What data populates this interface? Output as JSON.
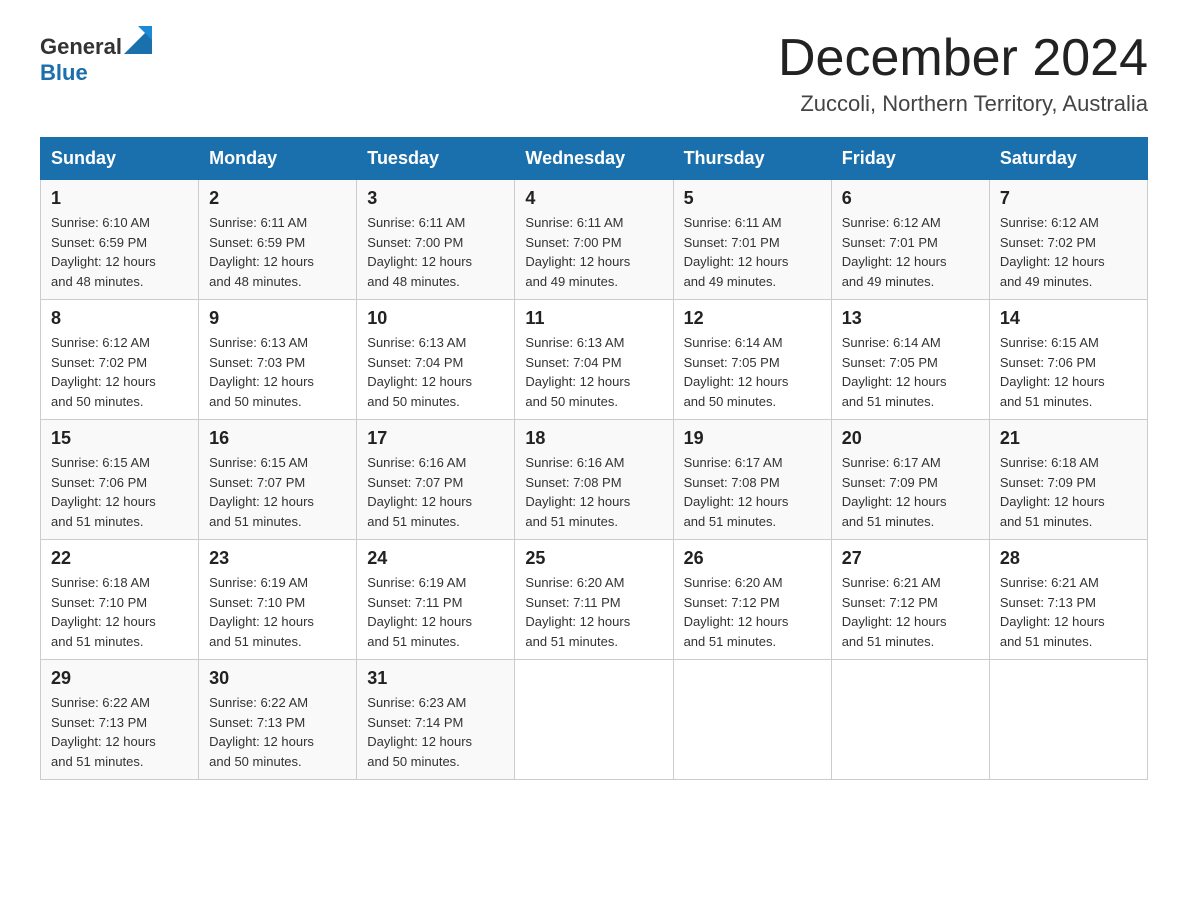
{
  "header": {
    "logo_general": "General",
    "logo_blue": "Blue",
    "month_title": "December 2024",
    "location": "Zuccoli, Northern Territory, Australia"
  },
  "days_of_week": [
    "Sunday",
    "Monday",
    "Tuesday",
    "Wednesday",
    "Thursday",
    "Friday",
    "Saturday"
  ],
  "weeks": [
    [
      {
        "day": "1",
        "sunrise": "6:10 AM",
        "sunset": "6:59 PM",
        "daylight": "12 hours and 48 minutes."
      },
      {
        "day": "2",
        "sunrise": "6:11 AM",
        "sunset": "6:59 PM",
        "daylight": "12 hours and 48 minutes."
      },
      {
        "day": "3",
        "sunrise": "6:11 AM",
        "sunset": "7:00 PM",
        "daylight": "12 hours and 48 minutes."
      },
      {
        "day": "4",
        "sunrise": "6:11 AM",
        "sunset": "7:00 PM",
        "daylight": "12 hours and 49 minutes."
      },
      {
        "day": "5",
        "sunrise": "6:11 AM",
        "sunset": "7:01 PM",
        "daylight": "12 hours and 49 minutes."
      },
      {
        "day": "6",
        "sunrise": "6:12 AM",
        "sunset": "7:01 PM",
        "daylight": "12 hours and 49 minutes."
      },
      {
        "day": "7",
        "sunrise": "6:12 AM",
        "sunset": "7:02 PM",
        "daylight": "12 hours and 49 minutes."
      }
    ],
    [
      {
        "day": "8",
        "sunrise": "6:12 AM",
        "sunset": "7:02 PM",
        "daylight": "12 hours and 50 minutes."
      },
      {
        "day": "9",
        "sunrise": "6:13 AM",
        "sunset": "7:03 PM",
        "daylight": "12 hours and 50 minutes."
      },
      {
        "day": "10",
        "sunrise": "6:13 AM",
        "sunset": "7:04 PM",
        "daylight": "12 hours and 50 minutes."
      },
      {
        "day": "11",
        "sunrise": "6:13 AM",
        "sunset": "7:04 PM",
        "daylight": "12 hours and 50 minutes."
      },
      {
        "day": "12",
        "sunrise": "6:14 AM",
        "sunset": "7:05 PM",
        "daylight": "12 hours and 50 minutes."
      },
      {
        "day": "13",
        "sunrise": "6:14 AM",
        "sunset": "7:05 PM",
        "daylight": "12 hours and 51 minutes."
      },
      {
        "day": "14",
        "sunrise": "6:15 AM",
        "sunset": "7:06 PM",
        "daylight": "12 hours and 51 minutes."
      }
    ],
    [
      {
        "day": "15",
        "sunrise": "6:15 AM",
        "sunset": "7:06 PM",
        "daylight": "12 hours and 51 minutes."
      },
      {
        "day": "16",
        "sunrise": "6:15 AM",
        "sunset": "7:07 PM",
        "daylight": "12 hours and 51 minutes."
      },
      {
        "day": "17",
        "sunrise": "6:16 AM",
        "sunset": "7:07 PM",
        "daylight": "12 hours and 51 minutes."
      },
      {
        "day": "18",
        "sunrise": "6:16 AM",
        "sunset": "7:08 PM",
        "daylight": "12 hours and 51 minutes."
      },
      {
        "day": "19",
        "sunrise": "6:17 AM",
        "sunset": "7:08 PM",
        "daylight": "12 hours and 51 minutes."
      },
      {
        "day": "20",
        "sunrise": "6:17 AM",
        "sunset": "7:09 PM",
        "daylight": "12 hours and 51 minutes."
      },
      {
        "day": "21",
        "sunrise": "6:18 AM",
        "sunset": "7:09 PM",
        "daylight": "12 hours and 51 minutes."
      }
    ],
    [
      {
        "day": "22",
        "sunrise": "6:18 AM",
        "sunset": "7:10 PM",
        "daylight": "12 hours and 51 minutes."
      },
      {
        "day": "23",
        "sunrise": "6:19 AM",
        "sunset": "7:10 PM",
        "daylight": "12 hours and 51 minutes."
      },
      {
        "day": "24",
        "sunrise": "6:19 AM",
        "sunset": "7:11 PM",
        "daylight": "12 hours and 51 minutes."
      },
      {
        "day": "25",
        "sunrise": "6:20 AM",
        "sunset": "7:11 PM",
        "daylight": "12 hours and 51 minutes."
      },
      {
        "day": "26",
        "sunrise": "6:20 AM",
        "sunset": "7:12 PM",
        "daylight": "12 hours and 51 minutes."
      },
      {
        "day": "27",
        "sunrise": "6:21 AM",
        "sunset": "7:12 PM",
        "daylight": "12 hours and 51 minutes."
      },
      {
        "day": "28",
        "sunrise": "6:21 AM",
        "sunset": "7:13 PM",
        "daylight": "12 hours and 51 minutes."
      }
    ],
    [
      {
        "day": "29",
        "sunrise": "6:22 AM",
        "sunset": "7:13 PM",
        "daylight": "12 hours and 51 minutes."
      },
      {
        "day": "30",
        "sunrise": "6:22 AM",
        "sunset": "7:13 PM",
        "daylight": "12 hours and 50 minutes."
      },
      {
        "day": "31",
        "sunrise": "6:23 AM",
        "sunset": "7:14 PM",
        "daylight": "12 hours and 50 minutes."
      },
      null,
      null,
      null,
      null
    ]
  ],
  "labels": {
    "sunrise": "Sunrise:",
    "sunset": "Sunset:",
    "daylight": "Daylight:"
  }
}
